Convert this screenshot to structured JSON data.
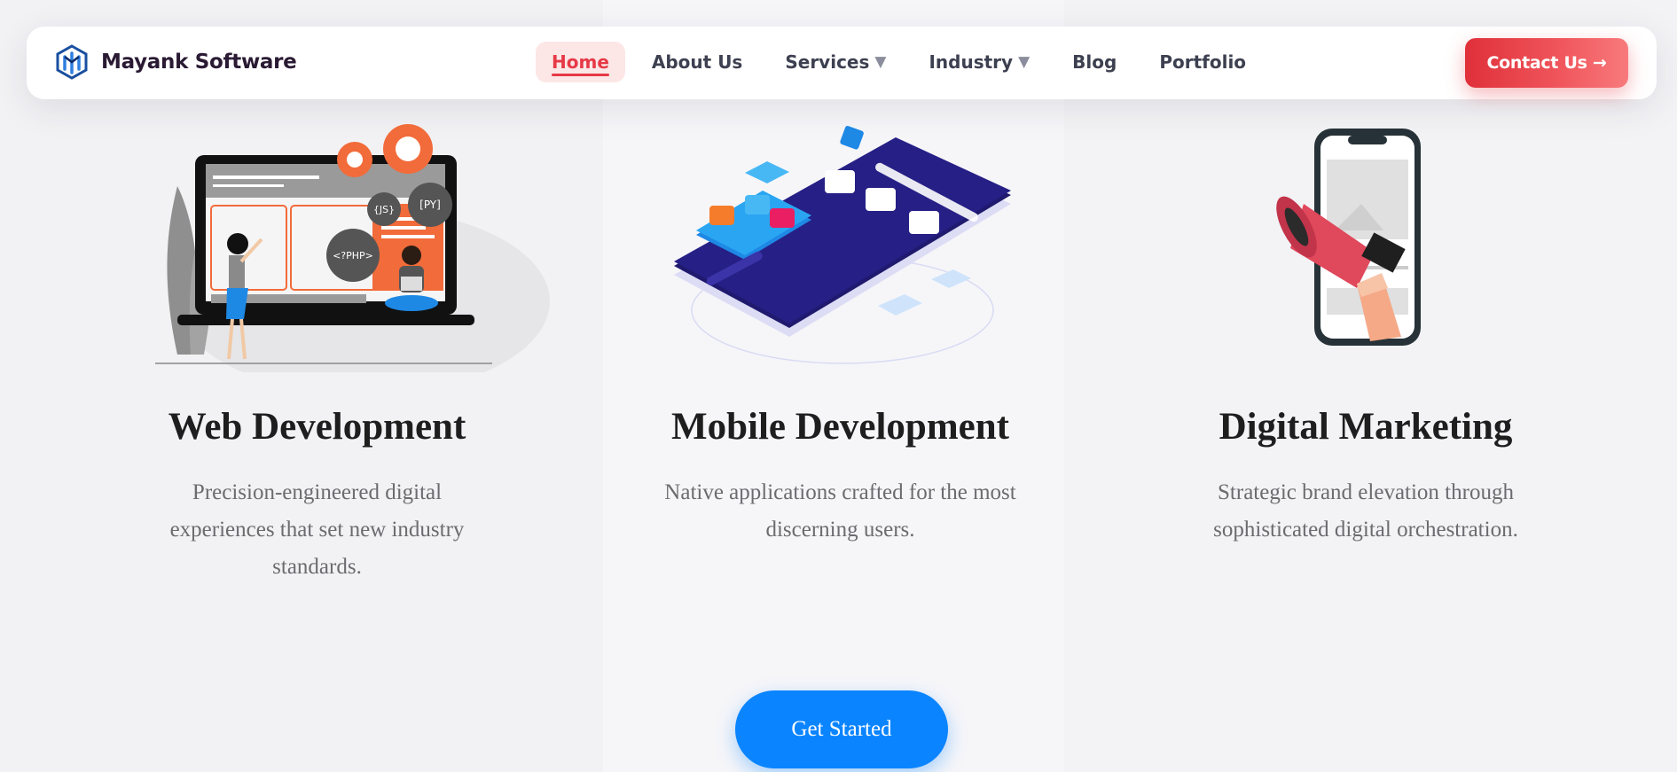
{
  "nav": {
    "brand": "Mayank Software",
    "links": [
      {
        "label": "Home",
        "active": true
      },
      {
        "label": "About Us"
      },
      {
        "label": "Services",
        "caret": "▼"
      },
      {
        "label": "Industry",
        "caret": "▼"
      },
      {
        "label": "Blog"
      },
      {
        "label": "Portfolio"
      }
    ],
    "cta": "Contact Us →"
  },
  "services": [
    {
      "title": "Web Development",
      "description": "Precision-engineered digital experiences that set new industry standards.",
      "illustration_labels": [
        "{JS}",
        "[PY]",
        "<?PHP>"
      ]
    },
    {
      "title": "Mobile Development",
      "description": "Native applications crafted for the most discerning users."
    },
    {
      "title": "Digital Marketing",
      "description": "Strategic brand elevation through sophisticated digital orchestration."
    }
  ],
  "cta_button": "Get Started",
  "colors": {
    "accent": "#e63946",
    "primary_button": "#0a84ff",
    "nav_text": "#3d4050",
    "heading": "#1e1e1e",
    "body_text": "#6b6b70"
  },
  "icons": [
    "logo-icon",
    "web-dev-illustration",
    "mobile-dev-illustration",
    "megaphone-illustration"
  ]
}
